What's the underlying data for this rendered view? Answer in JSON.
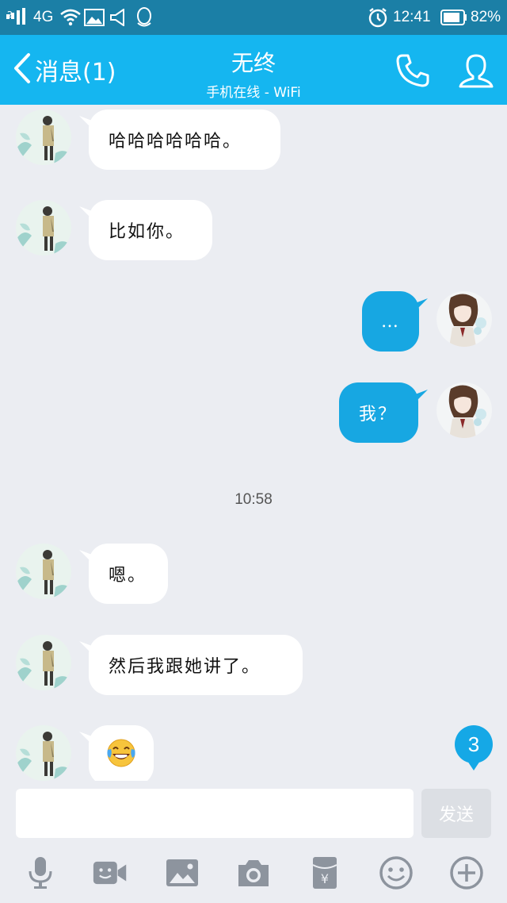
{
  "status_bar": {
    "sim_label": "2",
    "network": "4G",
    "time": "12:41",
    "battery": "82%"
  },
  "header": {
    "back_label": "消息(1)",
    "contact_name": "无终",
    "contact_status": "手机在线 - WiFi"
  },
  "messages": [
    {
      "side": "in",
      "text": "哈哈哈哈哈哈。"
    },
    {
      "side": "in",
      "text": "比如你。"
    },
    {
      "side": "out",
      "text": "…"
    },
    {
      "side": "out",
      "text": "我？"
    },
    {
      "time": "10:58"
    },
    {
      "side": "in",
      "text": "嗯。"
    },
    {
      "side": "in",
      "text": "然后我跟她讲了。"
    },
    {
      "side": "in",
      "emoji": "😂"
    }
  ],
  "unread_count": "3",
  "input": {
    "placeholder": "",
    "value": "",
    "send_label": "发送"
  },
  "toolbar": [
    "microphone-icon",
    "video-icon",
    "image-icon",
    "camera-icon",
    "red-packet-icon",
    "emoji-icon",
    "plus-icon"
  ],
  "colors": {
    "status_bar": "#1b7fa6",
    "header": "#15b6f0",
    "outgoing_bubble": "#17a7e2",
    "incoming_bubble": "#ffffff",
    "background": "#ebedf2",
    "toolbar_icon": "#8d949e"
  }
}
